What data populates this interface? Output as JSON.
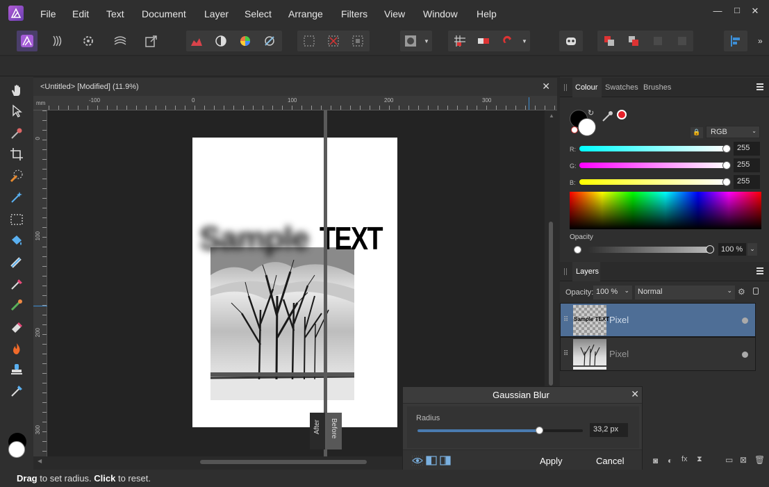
{
  "menu": [
    "File",
    "Edit",
    "Text",
    "Document",
    "Layer",
    "Select",
    "Arrange",
    "Filters",
    "View",
    "Window",
    "Help"
  ],
  "window_controls": {
    "minimize": "—",
    "maximize": "□",
    "close": "✕"
  },
  "document": {
    "title": "<Untitled> [Modified] (11.9%)",
    "close": "✕",
    "ruler_unit": "mm",
    "ruler_h": [
      "-100",
      "0",
      "100",
      "200",
      "300"
    ],
    "ruler_v": [
      "0",
      "100",
      "200",
      "300"
    ]
  },
  "canvas": {
    "text_blur": "Sample ",
    "text_sharp": "TEXT",
    "after": "After",
    "before": "Before"
  },
  "colour_panel": {
    "tabs": [
      "Colour",
      "Swatches",
      "Brushes"
    ],
    "mode": "RGB",
    "channels": [
      {
        "label": "R:",
        "value": "255"
      },
      {
        "label": "G:",
        "value": "255"
      },
      {
        "label": "B:",
        "value": "255"
      }
    ],
    "opacity_label": "Opacity",
    "opacity_value": "100 %"
  },
  "layers_panel": {
    "tab": "Layers",
    "opacity_label": "Opacity:",
    "opacity_value": "100 %",
    "blend_mode": "Normal",
    "layers": [
      {
        "name": "Pixel",
        "thumb_text": "Sample TEXT",
        "selected": true
      },
      {
        "name": "Pixel",
        "thumb_text": "",
        "selected": false
      }
    ]
  },
  "dialog": {
    "title": "Gaussian Blur",
    "close": "✕",
    "radius_label": "Radius",
    "radius_value": "33,2 px",
    "radius_fraction": 0.74,
    "apply": "Apply",
    "cancel": "Cancel"
  },
  "status": {
    "drag": "Drag",
    "drag_text": " to set radius. ",
    "click": "Click",
    "click_text": " to reset."
  },
  "colors": {
    "selection": "#4e6e96",
    "accent_blue": "#3d8fd6",
    "primary_red": "#e5202a"
  }
}
